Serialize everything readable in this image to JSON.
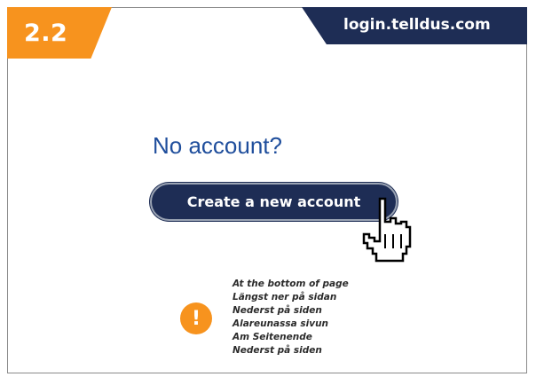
{
  "step": {
    "label": "2.2",
    "color": "#f7931e"
  },
  "header": {
    "url": "login.telldus.com",
    "color": "#1e2d55"
  },
  "main": {
    "heading": "No account?",
    "heading_color": "#1f4e9c",
    "create_button_label": "Create a new account",
    "button_color": "#1e2d55",
    "cursor_icon": "hand-pointer-icon"
  },
  "hint": {
    "icon": "exclamation-icon",
    "icon_color": "#f7931e",
    "lines": [
      "At the bottom of page",
      "Längst ner på sidan",
      "Nederst på siden",
      "Alareunassa sivun",
      "Am Seitenende",
      "Nederst på siden"
    ]
  }
}
